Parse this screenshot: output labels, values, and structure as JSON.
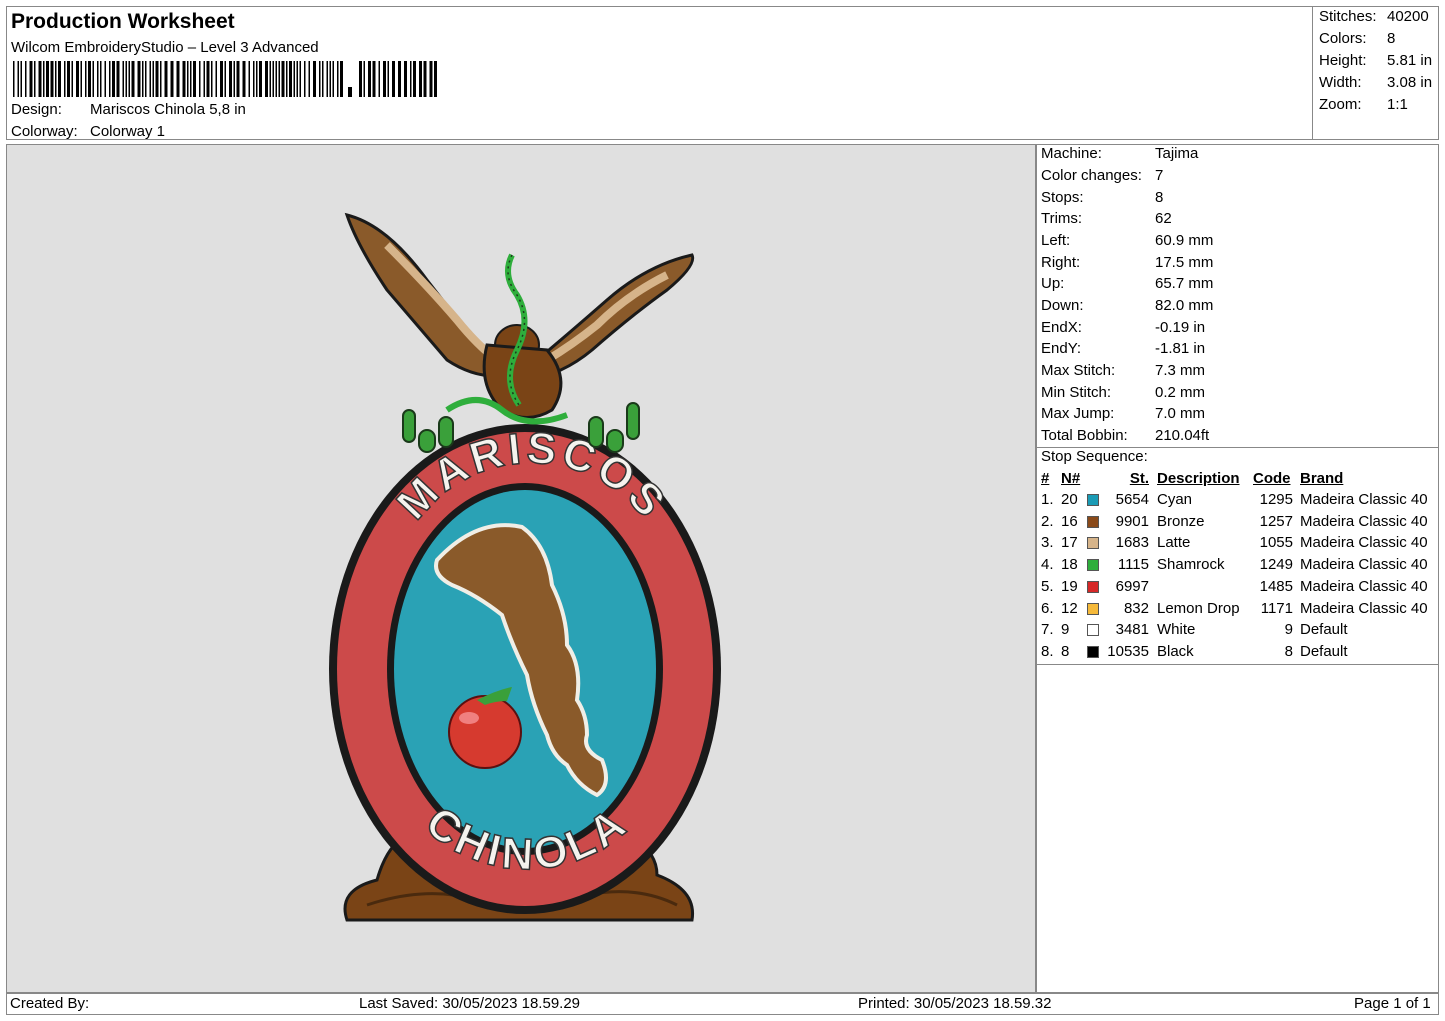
{
  "header": {
    "title": "Production Worksheet",
    "subtitle": "Wilcom EmbroideryStudio – Level 3 Advanced",
    "design_label": "Design:",
    "design_value": "Mariscos Chinola 5,8 in",
    "colorway_label": "Colorway:",
    "colorway_value": "Colorway 1"
  },
  "stats": [
    {
      "label": "Stitches:",
      "value": "40200"
    },
    {
      "label": "Colors:",
      "value": "8"
    },
    {
      "label": "Height:",
      "value": "5.81 in"
    },
    {
      "label": "Width:",
      "value": "3.08 in"
    },
    {
      "label": "Zoom:",
      "value": "1:1"
    }
  ],
  "info": [
    {
      "label": "Machine:",
      "value": "Tajima"
    },
    {
      "label": "Color changes:",
      "value": "7"
    },
    {
      "label": "Stops:",
      "value": "8"
    },
    {
      "label": "Trims:",
      "value": "62"
    },
    {
      "label": "Left:",
      "value": "60.9 mm"
    },
    {
      "label": "Right:",
      "value": "17.5 mm"
    },
    {
      "label": "Up:",
      "value": "65.7 mm"
    },
    {
      "label": "Down:",
      "value": "82.0 mm"
    },
    {
      "label": "EndX:",
      "value": "-0.19 in"
    },
    {
      "label": "EndY:",
      "value": "-1.81 in"
    },
    {
      "label": "Max Stitch:",
      "value": "7.3 mm"
    },
    {
      "label": "Min Stitch:",
      "value": "0.2 mm"
    },
    {
      "label": "Max Jump:",
      "value": "7.0 mm"
    },
    {
      "label": "Total Bobbin:",
      "value": "210.04ft"
    }
  ],
  "stop_sequence": {
    "title": "Stop Sequence:",
    "headers": {
      "idx": "#",
      "n": "N#",
      "st": "St.",
      "desc": "Description",
      "code": "Code",
      "brand": "Brand"
    },
    "rows": [
      {
        "idx": "1.",
        "n": "20",
        "color": "#1a9bb5",
        "st": "5654",
        "desc": "Cyan",
        "code": "1295",
        "brand": "Madeira Classic 40"
      },
      {
        "idx": "2.",
        "n": "16",
        "color": "#8a4a1a",
        "st": "9901",
        "desc": "Bronze",
        "code": "1257",
        "brand": "Madeira Classic 40"
      },
      {
        "idx": "3.",
        "n": "17",
        "color": "#d6b48a",
        "st": "1683",
        "desc": "Latte",
        "code": "1055",
        "brand": "Madeira Classic 40"
      },
      {
        "idx": "4.",
        "n": "18",
        "color": "#2fae3c",
        "st": "1115",
        "desc": "Shamrock",
        "code": "1249",
        "brand": "Madeira Classic 40"
      },
      {
        "idx": "5.",
        "n": "19",
        "color": "#d62828",
        "st": "6997",
        "desc": "",
        "code": "1485",
        "brand": "Madeira Classic 40"
      },
      {
        "idx": "6.",
        "n": "12",
        "color": "#f5b93a",
        "st": "832",
        "desc": "Lemon Drop",
        "code": "1171",
        "brand": "Madeira Classic 40"
      },
      {
        "idx": "7.",
        "n": "9",
        "color": "#ffffff",
        "st": "3481",
        "desc": "White",
        "code": "9",
        "brand": "Default"
      },
      {
        "idx": "8.",
        "n": "8",
        "color": "#000000",
        "st": "10535",
        "desc": "Black",
        "code": "8",
        "brand": "Default"
      }
    ]
  },
  "design_text": {
    "top": "MARISCOS",
    "bottom": "CHINOLA"
  },
  "footer": {
    "created": "Created By:",
    "saved": "Last Saved: 30/05/2023 18.59.29",
    "printed": "Printed: 30/05/2023 18.59.32",
    "page": "Page 1 of 1"
  }
}
